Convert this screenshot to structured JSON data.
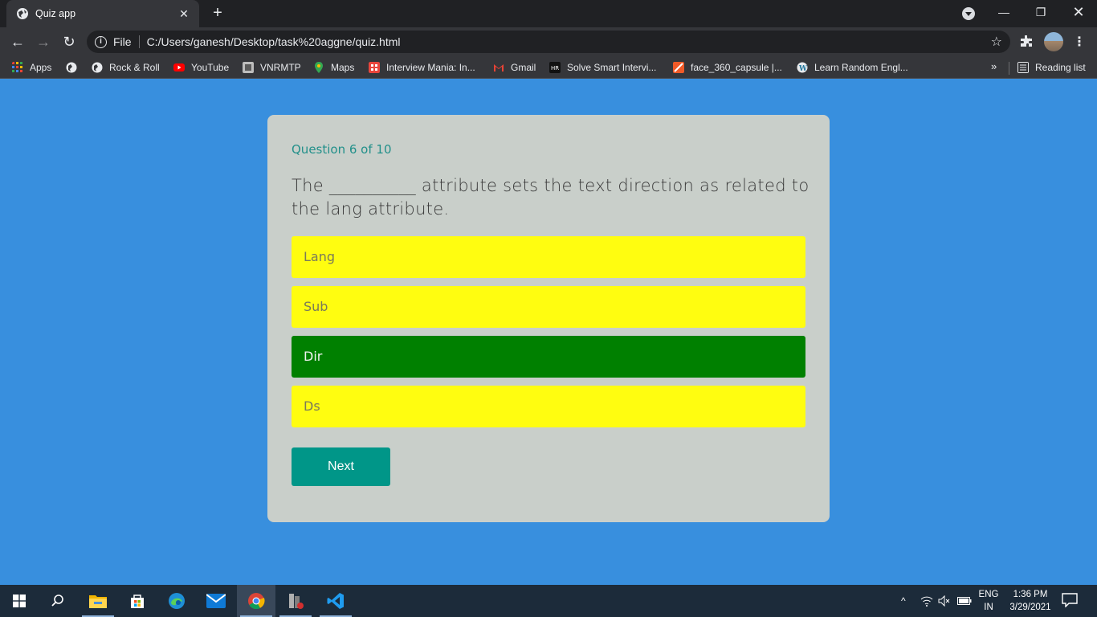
{
  "browser": {
    "tab_title": "Quiz app",
    "tab_close": "✕",
    "new_tab": "+",
    "url_scheme_label": "File",
    "url": "C:/Users/ganesh/Desktop/task%20aggne/quiz.html",
    "bookmarks": [
      {
        "label": "Apps",
        "icon": "apps-grid-icon",
        "color": "#e8453c"
      },
      {
        "label": "",
        "icon": "globe-icon",
        "color": "#e8eaed"
      },
      {
        "label": "Rock & Roll",
        "icon": "globe-icon",
        "color": "#e8eaed"
      },
      {
        "label": "YouTube",
        "icon": "youtube-icon",
        "color": "#ff0000"
      },
      {
        "label": "VNRMTP",
        "icon": "vnrmtp-icon",
        "color": "#bdbdbd"
      },
      {
        "label": "Maps",
        "icon": "maps-pin-icon",
        "color": "#34a853"
      },
      {
        "label": "Interview Mania: In...",
        "icon": "interview-mania-icon",
        "color": "#e8453c"
      },
      {
        "label": "Gmail",
        "icon": "gmail-icon",
        "color": "#ea4335"
      },
      {
        "label": "Solve Smart Intervi...",
        "icon": "hackerrank-icon",
        "color": "#111111"
      },
      {
        "label": "face_360_capsule |...",
        "icon": "capsule-icon",
        "color": "#f05a28"
      },
      {
        "label": "Learn Random Engl...",
        "icon": "wordpress-icon",
        "color": "#e8eaed"
      }
    ],
    "bookmarks_more": "»",
    "reading_list": "Reading list"
  },
  "quiz": {
    "counter": "Question 6 of 10",
    "question": "The __________ attribute sets the text direction as related to the lang attribute.",
    "options": [
      {
        "label": "Lang",
        "state": "default"
      },
      {
        "label": "Sub",
        "state": "default"
      },
      {
        "label": "Dir",
        "state": "correct"
      },
      {
        "label": "Ds",
        "state": "default"
      }
    ],
    "next_label": "Next"
  },
  "colors": {
    "page_background": "#388fde",
    "card_background": "#c9cfca",
    "option_default": "#fffd10",
    "option_correct": "#008000",
    "accent_teal": "#009688"
  },
  "taskbar": {
    "apps": [
      "start-icon",
      "search-icon",
      "file-explorer-icon",
      "store-icon",
      "edge-icon",
      "mail-icon",
      "chrome-icon",
      "app-icon",
      "vscode-icon"
    ],
    "language_top": "ENG",
    "language_bottom": "IN",
    "time": "1:36 PM",
    "date": "3/29/2021"
  }
}
